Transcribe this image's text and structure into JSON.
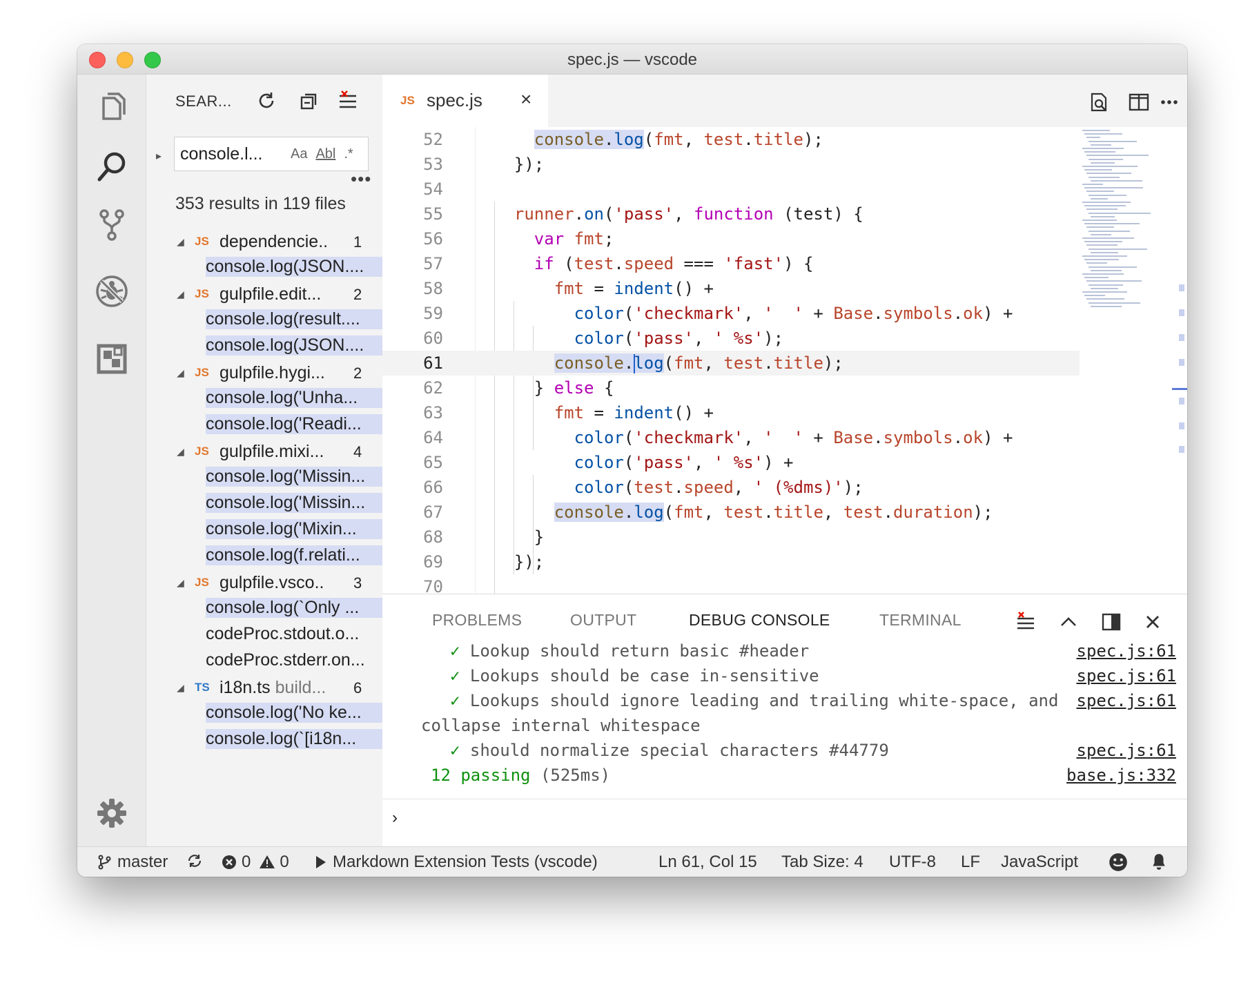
{
  "window": {
    "title": "spec.js — vscode"
  },
  "activity_bar": {
    "items": [
      {
        "name": "explorer-icon"
      },
      {
        "name": "search-icon"
      },
      {
        "name": "source-control-icon"
      },
      {
        "name": "debug-icon"
      },
      {
        "name": "extensions-icon"
      }
    ],
    "settings_icon": "gear-icon"
  },
  "sidebar": {
    "title": "SEAR...",
    "search": {
      "value": "console.l...",
      "match_case": "Aa",
      "whole_word": "Abl",
      "regex": ".*"
    },
    "more": "•••",
    "summary": "353 results in 119 files",
    "files": [
      {
        "lang": "JS",
        "name": "dependencie..",
        "path": "",
        "count": "1",
        "matches": [
          "console.log(JSON...."
        ]
      },
      {
        "lang": "JS",
        "name": "gulpfile.edit...",
        "path": "",
        "count": "2",
        "matches": [
          "console.log(result....",
          "console.log(JSON...."
        ]
      },
      {
        "lang": "JS",
        "name": "gulpfile.hygi...",
        "path": "",
        "count": "2",
        "matches": [
          "console.log('Unha...",
          "console.log('Readi..."
        ]
      },
      {
        "lang": "JS",
        "name": "gulpfile.mixi...",
        "path": "",
        "count": "4",
        "matches": [
          "console.log('Missin...",
          "console.log('Missin...",
          "console.log('Mixin...",
          "console.log(f.relati..."
        ]
      },
      {
        "lang": "JS",
        "name": "gulpfile.vsco..",
        "path": "",
        "count": "3",
        "matches": [
          "console.log(`Only ...",
          "codeProc.stdout.o...",
          "codeProc.stderr.on..."
        ]
      },
      {
        "lang": "TS",
        "name": "i18n.ts",
        "path": "build...",
        "count": "6",
        "matches": [
          "console.log('No ke...",
          "console.log(`[i18n..."
        ]
      }
    ]
  },
  "editor": {
    "tab": {
      "lang": "JS",
      "label": "spec.js",
      "close": "×"
    },
    "current_line": 61,
    "lines": [
      {
        "n": "52",
        "text": "    console.log(fmt, test.title);"
      },
      {
        "n": "53",
        "text": "  });"
      },
      {
        "n": "54",
        "text": ""
      },
      {
        "n": "55",
        "text": "  runner.on('pass', function (test) {"
      },
      {
        "n": "56",
        "text": "    var fmt;"
      },
      {
        "n": "57",
        "text": "    if (test.speed === 'fast') {"
      },
      {
        "n": "58",
        "text": "      fmt = indent() +"
      },
      {
        "n": "59",
        "text": "        color('checkmark', '  ' + Base.symbols.ok) +"
      },
      {
        "n": "60",
        "text": "        color('pass', ' %s');"
      },
      {
        "n": "61",
        "text": "      console.log(fmt, test.title);"
      },
      {
        "n": "62",
        "text": "    } else {"
      },
      {
        "n": "63",
        "text": "      fmt = indent() +"
      },
      {
        "n": "64",
        "text": "        color('checkmark', '  ' + Base.symbols.ok) +"
      },
      {
        "n": "65",
        "text": "        color('pass', ' %s') +"
      },
      {
        "n": "66",
        "text": "        color(test.speed, ' (%dms)');"
      },
      {
        "n": "67",
        "text": "      console.log(fmt, test.title, test.duration);"
      },
      {
        "n": "68",
        "text": "    }"
      },
      {
        "n": "69",
        "text": "  });"
      },
      {
        "n": "70",
        "text": ""
      }
    ]
  },
  "panel": {
    "tabs": [
      "PROBLEMS",
      "OUTPUT",
      "DEBUG CONSOLE",
      "TERMINAL"
    ],
    "active_tab": "DEBUG CONSOLE",
    "console": [
      {
        "check": "✓",
        "text": "Lookup should return basic #header",
        "src": "spec.js:61"
      },
      {
        "check": "✓",
        "text": "Lookups should be case in-sensitive",
        "src": "spec.js:61"
      },
      {
        "check": "✓",
        "text": "Lookups should ignore leading and trailing white-space, and",
        "src": "spec.js:61"
      },
      {
        "check": "",
        "text": "collapse internal whitespace",
        "src": ""
      },
      {
        "check": "✓",
        "text": "should normalize special characters #44779",
        "src": "spec.js:61"
      }
    ],
    "summary": {
      "count": "12 passing",
      "time": "(525ms)",
      "src": "base.js:332"
    },
    "prompt": "›"
  },
  "statusbar": {
    "branch": "master",
    "errors": "0",
    "warnings": "0",
    "launch": "Markdown Extension Tests (vscode)",
    "position": "Ln 61, Col 15",
    "tab_size": "Tab Size: 4",
    "encoding": "UTF-8",
    "eol": "LF",
    "language": "JavaScript"
  },
  "colors": {
    "match_highlight": "#d6dcf3",
    "js_badge": "#e2752b",
    "ts_badge": "#3178c6",
    "pass_green": "#109010"
  }
}
